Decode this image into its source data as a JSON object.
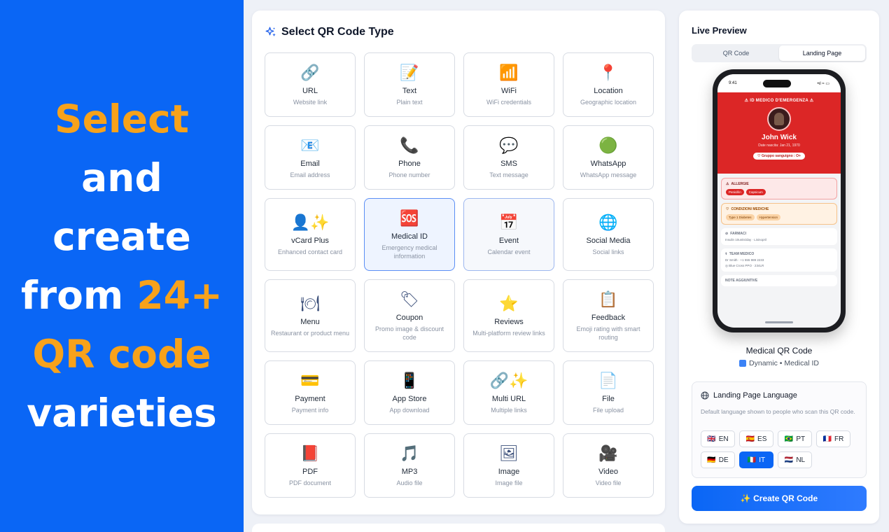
{
  "promo": {
    "line1": "Select",
    "line2": "and",
    "line3": "create",
    "line4a": "from ",
    "line4b": "24+",
    "line5": "QR code",
    "line6": "varieties",
    "highlight_color": "#f7a21b",
    "bg_color": "#0a66f5"
  },
  "selector": {
    "title": "Select QR Code Type",
    "icon": "sparkles-icon",
    "tiles": [
      {
        "id": "url",
        "icon": "🔗",
        "title": "URL",
        "desc": "Website link"
      },
      {
        "id": "text",
        "icon": "📝",
        "title": "Text",
        "desc": "Plain text"
      },
      {
        "id": "wifi",
        "icon": "📶",
        "title": "WiFi",
        "desc": "WiFi credentials"
      },
      {
        "id": "location",
        "icon": "📍",
        "title": "Location",
        "desc": "Geographic location"
      },
      {
        "id": "email",
        "icon": "📧",
        "title": "Email",
        "desc": "Email address"
      },
      {
        "id": "phone",
        "icon": "📞",
        "title": "Phone",
        "desc": "Phone number"
      },
      {
        "id": "sms",
        "icon": "💬",
        "title": "SMS",
        "desc": "Text message"
      },
      {
        "id": "whatsapp",
        "icon": "🟢",
        "title": "WhatsApp",
        "desc": "WhatsApp message"
      },
      {
        "id": "vcard",
        "icon": "👤✨",
        "title": "vCard Plus",
        "desc": "Enhanced contact card"
      },
      {
        "id": "medical",
        "icon": "🆘",
        "title": "Medical ID",
        "desc": "Emergency medical information"
      },
      {
        "id": "event",
        "icon": "📅",
        "title": "Event",
        "desc": "Calendar event"
      },
      {
        "id": "social",
        "icon": "🌐",
        "title": "Social Media",
        "desc": "Social links"
      },
      {
        "id": "menu",
        "icon": "🍽",
        "title": "Menu",
        "desc": "Restaurant or product menu"
      },
      {
        "id": "coupon",
        "icon": "🏷",
        "title": "Coupon",
        "desc": "Promo image & discount code"
      },
      {
        "id": "reviews",
        "icon": "⭐",
        "title": "Reviews",
        "desc": "Multi-platform review links"
      },
      {
        "id": "feedback",
        "icon": "📋",
        "title": "Feedback",
        "desc": "Emoji rating with smart routing"
      },
      {
        "id": "payment",
        "icon": "💳",
        "title": "Payment",
        "desc": "Payment info"
      },
      {
        "id": "appstore",
        "icon": "📱",
        "title": "App Store",
        "desc": "App download"
      },
      {
        "id": "multiurl",
        "icon": "🔗✨",
        "title": "Multi URL",
        "desc": "Multiple links"
      },
      {
        "id": "file",
        "icon": "📄",
        "title": "File",
        "desc": "File upload"
      },
      {
        "id": "pdf",
        "icon": "📕",
        "title": "PDF",
        "desc": "PDF document"
      },
      {
        "id": "mp3",
        "icon": "🎵",
        "title": "MP3",
        "desc": "Audio file"
      },
      {
        "id": "image",
        "icon": "🖼",
        "title": "Image",
        "desc": "Image file"
      },
      {
        "id": "video",
        "icon": "🎥",
        "title": "Video",
        "desc": "Video file"
      }
    ]
  },
  "preview": {
    "title": "Live Preview",
    "tabs": [
      "QR Code",
      "Landing Page"
    ],
    "active_tab": "Landing Page",
    "phone": {
      "time": "9:41",
      "signal": "•ıl ≈ ▭",
      "header_label": "⚠ ID MEDICO D'EMERGENZA ⚠",
      "name": "John Wick",
      "dob": "Date nascita: Jan 21, 1970",
      "blood": "♡ Gruppo sanguigno : O+",
      "allergies_h": "ALLERGIE",
      "allergies": [
        "Penicillin",
        "Capsicum"
      ],
      "conditions_h": "CONDIZIONI MEDICHE",
      "conditions": [
        "Type 1 Diabetes",
        "Hypertension"
      ],
      "meds_h": "FARMACI",
      "meds_line": "Insulin 10units/day · Lisinopril",
      "team_h": "TEAM MEDICO",
      "team_line1": "Dr Smith · +1 555 989 2233",
      "team_line2": "◎ Blue Cross PPO · 234LR",
      "notes_h": "NOTE AGGIUNTIVE"
    },
    "name": "Medical QR Code",
    "sub": "Dynamic • Medical ID",
    "language": {
      "title": "Landing Page Language",
      "desc": "Default language shown to people who scan this QR code.",
      "options": [
        {
          "code": "EN",
          "flag": "🇬🇧"
        },
        {
          "code": "ES",
          "flag": "🇪🇸"
        },
        {
          "code": "PT",
          "flag": "🇧🇷"
        },
        {
          "code": "FR",
          "flag": "🇫🇷"
        },
        {
          "code": "DE",
          "flag": "🇩🇪"
        },
        {
          "code": "IT",
          "flag": "🇮🇹"
        },
        {
          "code": "NL",
          "flag": "🇳🇱"
        }
      ],
      "selected": "IT"
    },
    "create_label": "✨ Create QR Code"
  }
}
